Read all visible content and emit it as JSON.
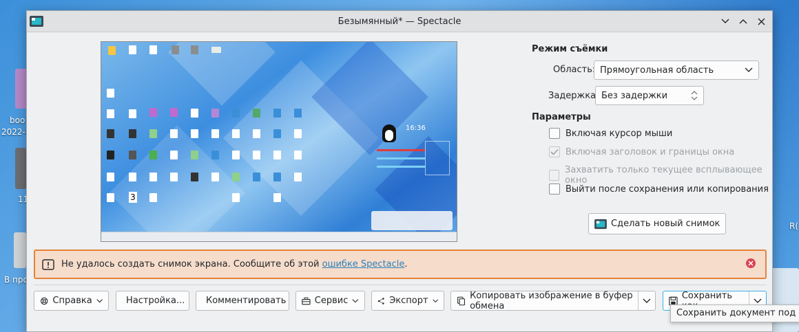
{
  "desktop": {
    "labels": [
      "boo",
      "2022-(",
      "11",
      "В про"
    ],
    "right_label": "R("
  },
  "window": {
    "title": "Безымянный* — Spectacle"
  },
  "preview": {
    "number_badge": "3",
    "clock": "16:36"
  },
  "capture": {
    "section_title": "Режим съёмки",
    "area_label": "Область:",
    "area_value": "Прямоугольная область",
    "delay_label": "Задержка:",
    "delay_value": "Без задержки"
  },
  "params": {
    "section_title": "Параметры",
    "options": [
      {
        "label": "Включая курсор мыши",
        "checked": false,
        "disabled": false
      },
      {
        "label": "Включая заголовок и границы окна",
        "checked": true,
        "disabled": true
      },
      {
        "label": "Захватить только текущее всплывающее окно",
        "checked": false,
        "disabled": true
      },
      {
        "label": "Выйти после сохранения или копирования",
        "checked": false,
        "disabled": false
      }
    ],
    "new_shot_label": "Сделать новый снимок"
  },
  "banner": {
    "message": "Не удалось создать снимок экрана. Сообщите об этой ",
    "link": "ошибке Spectacle",
    "suffix": "."
  },
  "toolbar": {
    "help": "Справка",
    "settings": "Настройка...",
    "annotate": "Комментировать",
    "tools": "Сервис",
    "export": "Экспорт",
    "copy": "Копировать изображение в буфер обмена",
    "save": "Сохранить как..."
  },
  "tooltip": {
    "text": "Сохранить документ под нов"
  }
}
